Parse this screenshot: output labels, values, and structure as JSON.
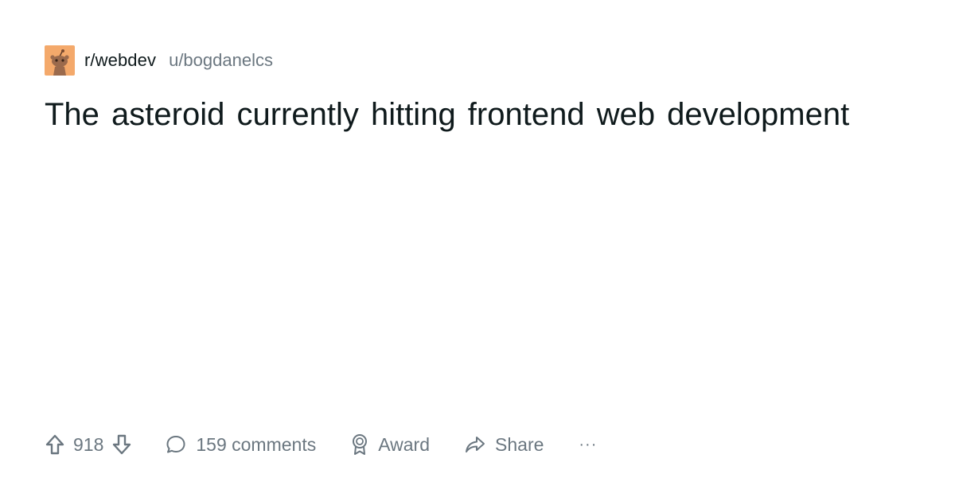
{
  "post": {
    "subreddit": "r/webdev",
    "author": "u/bogdanelcs",
    "title": "The asteroid currently hitting frontend web development"
  },
  "actions": {
    "upvote_icon": "arrow-up-outline-icon",
    "score": "918",
    "downvote_icon": "arrow-down-outline-icon",
    "comments_icon": "speech-bubble-icon",
    "comments_label": "159 comments",
    "award_icon": "award-medal-icon",
    "award_label": "Award",
    "share_icon": "share-arrow-icon",
    "share_label": "Share",
    "more_label": "···"
  },
  "colors": {
    "text_primary": "#0f1a1c",
    "text_secondary": "#6b7780",
    "avatar_bg": "#f4a96b",
    "background": "#ffffff"
  }
}
